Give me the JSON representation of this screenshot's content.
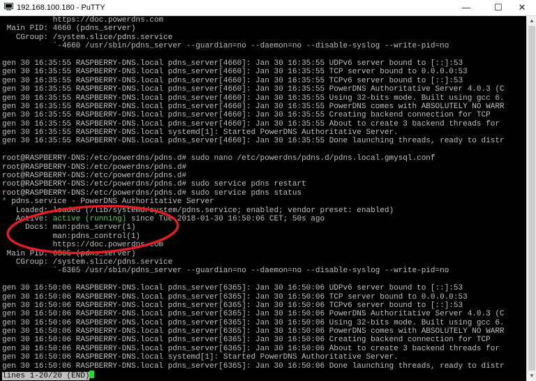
{
  "window": {
    "title": "192.168.100.180 - PuTTY",
    "controls": {
      "minimize": "—",
      "maximize": "☐",
      "close": "✕"
    }
  },
  "terminal": {
    "lines": [
      {
        "text": "           https://doc.powerdns.com"
      },
      {
        "text": " Main PID: 4660 (pdns_server)"
      },
      {
        "text": "   CGroup: /system.slice/pdns.service"
      },
      {
        "text": "           `-4660 /usr/sbin/pdns_server --guardian=no --daemon=no --disable-syslog --write-pid=no"
      },
      {
        "text": ""
      },
      {
        "text": "gen 30 16:35:55 RASPBERRY-DNS.local pdns_server[4660]: Jan 30 16:35:55 UDPv6 server bound to [::]:53"
      },
      {
        "text": "gen 30 16:35:55 RASPBERRY-DNS.local pdns_server[4660]: Jan 30 16:35:55 TCP server bound to 0.0.0.0:53"
      },
      {
        "text": "gen 30 16:35:55 RASPBERRY-DNS.local pdns_server[4660]: Jan 30 16:35:55 TCPv6 server bound to [::]:53"
      },
      {
        "text": "gen 30 16:35:55 RASPBERRY-DNS.local pdns_server[4660]: Jan 30 16:35:55 PowerDNS Authoritative Server 4.0.3 (C"
      },
      {
        "text": "gen 30 16:35:55 RASPBERRY-DNS.local pdns_server[4660]: Jan 30 16:35:55 Using 32-bits mode. Built using gcc 6."
      },
      {
        "text": "gen 30 16:35:55 RASPBERRY-DNS.local pdns_server[4660]: Jan 30 16:35:55 PowerDNS comes with ABSOLUTELY NO WARR"
      },
      {
        "text": "gen 30 16:35:55 RASPBERRY-DNS.local pdns_server[4660]: Jan 30 16:35:55 Creating backend connection for TCP"
      },
      {
        "text": "gen 30 16:35:55 RASPBERRY-DNS.local pdns_server[4660]: Jan 30 16:35:55 About to create 3 backend threads for"
      },
      {
        "text": "gen 30 16:35:55 RASPBERRY-DNS.local systemd[1]: Started PowerDNS Authoritative Server."
      },
      {
        "text": "gen 30 16:35:55 RASPBERRY-DNS.local pdns_server[4660]: Jan 30 16:35:55 Done launching threads, ready to distr"
      },
      {
        "text": ""
      },
      {
        "text": "root@RASPBERRY-DNS:/etc/powerdns/pdns.d# sudo nano /etc/powerdns/pdns.d/pdns.local.gmysql.conf"
      },
      {
        "text": "root@RASPBERRY-DNS:/etc/powerdns/pdns.d#"
      },
      {
        "text": "root@RASPBERRY-DNS:/etc/powerdns/pdns.d#"
      },
      {
        "text": "root@RASPBERRY-DNS:/etc/powerdns/pdns.d# sudo service pdns restart"
      },
      {
        "text": "root@RASPBERRY-DNS:/etc/powerdns/pdns.d# sudo service pdns status"
      },
      {
        "text": "* pdns.service - PowerDNS Authoritative Server",
        "prefix_green": "*",
        "rest": " pdns.service - PowerDNS Authoritative Server"
      },
      {
        "text": "   Loaded: loaded (/lib/systemd/system/pdns.service; enabled; vendor preset: enabled)"
      },
      {
        "text": "   Active: active (running) since Tue 2018-01-30 16:50:06 CET; 50s ago",
        "label": "   Active: ",
        "status": "active (running)",
        "after": " since Tue 2018-01-30 16:50:06 CET; 50s ago"
      },
      {
        "text": "     Docs: man:pdns_server(1)"
      },
      {
        "text": "           man:pdns_control(1)"
      },
      {
        "text": "           https://doc.powerdns.com"
      },
      {
        "text": " Main PID: 6365 (pdns_server)"
      },
      {
        "text": "   CGroup: /system.slice/pdns.service"
      },
      {
        "text": "           `-6365 /usr/sbin/pdns_server --guardian=no --daemon=no --disable-syslog --write-pid=no"
      },
      {
        "text": ""
      },
      {
        "text": "gen 30 16:50:06 RASPBERRY-DNS.local pdns_server[6365]: Jan 30 16:50:06 UDPv6 server bound to [::]:53"
      },
      {
        "text": "gen 30 16:50:06 RASPBERRY-DNS.local pdns_server[6365]: Jan 30 16:50:06 TCP server bound to 0.0.0.0:53"
      },
      {
        "text": "gen 30 16:50:06 RASPBERRY-DNS.local pdns_server[6365]: Jan 30 16:50:06 TCPv6 server bound to [::]:53"
      },
      {
        "text": "gen 30 16:50:06 RASPBERRY-DNS.local pdns_server[6365]: Jan 30 16:50:06 PowerDNS Authoritative Server 4.0.3 (C"
      },
      {
        "text": "gen 30 16:50:06 RASPBERRY-DNS.local pdns_server[6365]: Jan 30 16:50:06 Using 32-bits mode. Built using gcc 6."
      },
      {
        "text": "gen 30 16:50:06 RASPBERRY-DNS.local pdns_server[6365]: Jan 30 16:50:06 PowerDNS comes with ABSOLUTELY NO WARR"
      },
      {
        "text": "gen 30 16:50:06 RASPBERRY-DNS.local pdns_server[6365]: Jan 30 16:50:06 Creating backend connection for TCP"
      },
      {
        "text": "gen 30 16:50:06 RASPBERRY-DNS.local pdns_server[6365]: Jan 30 16:50:06 About to create 3 backend threads for"
      },
      {
        "text": "gen 30 16:50:06 RASPBERRY-DNS.local systemd[1]: Started PowerDNS Authoritative Server."
      },
      {
        "text": "gen 30 16:50:06 RASPBERRY-DNS.local pdns_server[6365]: Jan 30 16:50:06 Done launching threads, ready to distr"
      }
    ],
    "pager_status": "lines 1-20/20 (END)"
  },
  "colors": {
    "terminal_bg": "#000000",
    "terminal_fg": "#c0c0c0",
    "green": "#4cd84c",
    "annotation_red": "#e02020"
  }
}
